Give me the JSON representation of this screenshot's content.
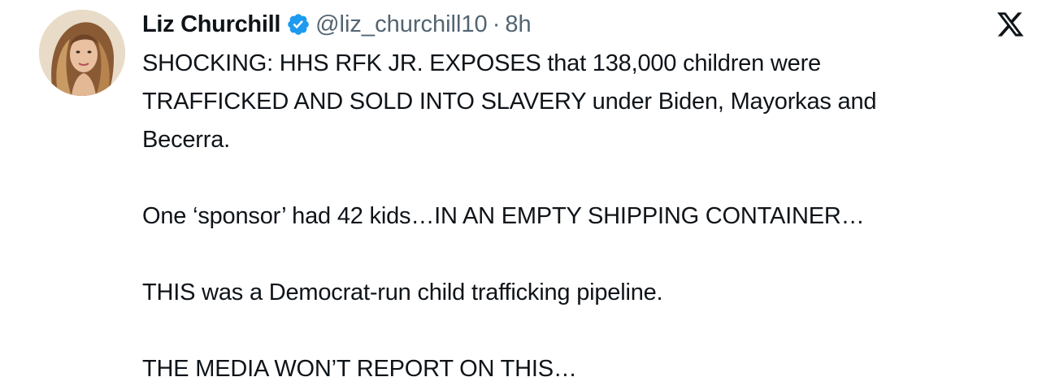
{
  "author": {
    "display_name": "Liz Churchill",
    "handle": "@liz_churchill10",
    "separator": "·",
    "time": "8h",
    "verified_color": "#1d9bf0"
  },
  "icons": {
    "avatar": "profile-photo",
    "verified": "verified-badge-icon",
    "close": "x-logo-icon"
  },
  "tweet": {
    "line1": "SHOCKING: HHS RFK JR. EXPOSES that 138,000 children were",
    "line2": "TRAFFICKED AND SOLD INTO SLAVERY under Biden, Mayorkas and",
    "line3": "Becerra.",
    "para2": "One ‘sponsor’ had 42 kids…IN AN EMPTY SHIPPING CONTAINER…",
    "para3": "THIS was a Democrat-run child trafficking pipeline.",
    "para4": "THE MEDIA WON’T REPORT ON THIS…"
  }
}
